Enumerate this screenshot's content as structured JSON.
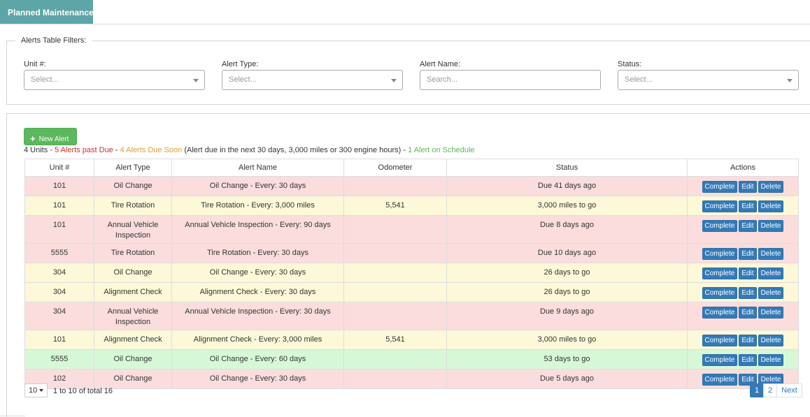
{
  "tab": {
    "label": "Planned Maintenance"
  },
  "filters": {
    "legend": "Alerts Table Filters:",
    "unit": {
      "label": "Unit #:",
      "placeholder": "Select..."
    },
    "alert_type": {
      "label": "Alert Type:",
      "placeholder": "Select..."
    },
    "alert_name": {
      "label": "Alert Name:",
      "placeholder": "Search..."
    },
    "status": {
      "label": "Status:",
      "placeholder": "Select..."
    }
  },
  "toolbar": {
    "new_alert_label": "New Alert"
  },
  "summary": {
    "units": "4 Units",
    "sep1": " - ",
    "past_due": "5 Alerts past Due",
    "sep2": " - ",
    "due_soon": "4 Alerts Due Soon",
    "due_soon_note": " (Alert due in the next 30 days, 3,000 miles or 300 engine hours) - ",
    "on_schedule": "1 Alert on Schedule"
  },
  "table": {
    "columns": [
      "Unit #",
      "Alert Type",
      "Alert Name",
      "Odometer",
      "Status",
      "Actions"
    ],
    "action_labels": {
      "complete": "Complete",
      "edit": "Edit",
      "delete": "Delete"
    },
    "rows": [
      {
        "unit": "101",
        "type": "Oil Change",
        "name": "Oil Change - Every: 30 days",
        "odometer": "",
        "status": "Due 41 days ago",
        "state": "red"
      },
      {
        "unit": "101",
        "type": "Tire Rotation",
        "name": "Tire Rotation - Every: 3,000 miles",
        "odometer": "5,541",
        "status": "3,000 miles to go",
        "state": "yellow"
      },
      {
        "unit": "101",
        "type": "Annual Vehicle Inspection",
        "name": "Annual Vehicle Inspection - Every: 90 days",
        "odometer": "",
        "status": "Due 8 days ago",
        "state": "red"
      },
      {
        "unit": "5555",
        "type": "Tire Rotation",
        "name": "Tire Rotation - Every: 30 days",
        "odometer": "",
        "status": "Due 10 days ago",
        "state": "red"
      },
      {
        "unit": "304",
        "type": "Oil Change",
        "name": "Oil Change - Every: 30 days",
        "odometer": "",
        "status": "26 days to go",
        "state": "yellow"
      },
      {
        "unit": "304",
        "type": "Alignment Check",
        "name": "Alignment Check - Every: 30 days",
        "odometer": "",
        "status": "26 days to go",
        "state": "yellow"
      },
      {
        "unit": "304",
        "type": "Annual Vehicle Inspection",
        "name": "Annual Vehicle Inspection - Every: 30 days",
        "odometer": "",
        "status": "Due 9 days ago",
        "state": "red"
      },
      {
        "unit": "101",
        "type": "Alignment Check",
        "name": "Alignment Check - Every: 3,000 miles",
        "odometer": "5,541",
        "status": "3,000 miles to go",
        "state": "yellow"
      },
      {
        "unit": "5555",
        "type": "Oil Change",
        "name": "Oil Change - Every: 60 days",
        "odometer": "",
        "status": "53 days to go",
        "state": "green"
      },
      {
        "unit": "102",
        "type": "Oil Change",
        "name": "Oil Change - Every: 30 days",
        "odometer": "",
        "status": "Due 5 days ago",
        "state": "red"
      }
    ]
  },
  "pagination": {
    "page_size": "10",
    "info": "1 to 10 of total 16",
    "pages": [
      "1",
      "2"
    ],
    "current_page": "1",
    "next_label": "Next"
  }
}
